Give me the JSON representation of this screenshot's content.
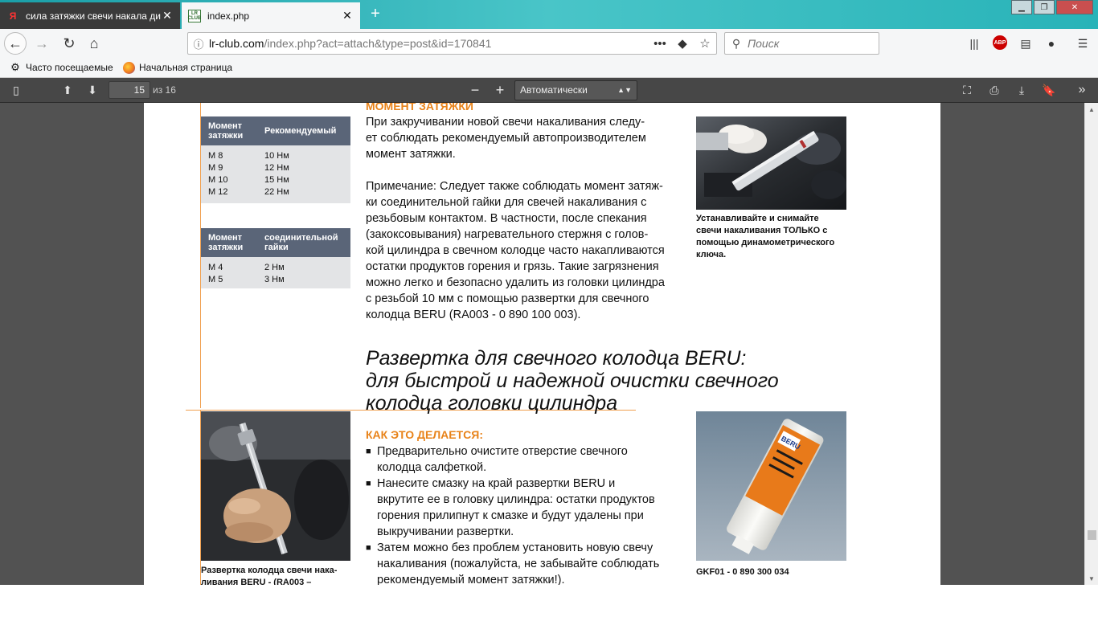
{
  "browser": {
    "tabs": [
      {
        "title": "сила затяжки свечи накала ди",
        "favicon": "Я",
        "active": false
      },
      {
        "title": "index.php",
        "favicon": "LR CLUB",
        "active": true
      }
    ],
    "url": {
      "domain": "lr-club.com",
      "path": "/index.php?act=attach&type=post&id=170841"
    },
    "search_placeholder": "Поиск",
    "bookmarks": [
      {
        "label": "Часто посещаемые",
        "icon": "gear-icon"
      },
      {
        "label": "Начальная страница",
        "icon": "firefox-icon"
      }
    ]
  },
  "pdf_toolbar": {
    "page_number": "15",
    "page_of": "из 16",
    "zoom": "Автоматически"
  },
  "document": {
    "torque_table1": {
      "col1": [
        "Момент",
        "затяжки"
      ],
      "col2": [
        "Рекомендуемый"
      ],
      "rows": [
        [
          "М 8",
          "10 Нм"
        ],
        [
          "М 9",
          "12 Нм"
        ],
        [
          "М 10",
          "15 Нм"
        ],
        [
          "М 12",
          "22 Нм"
        ]
      ]
    },
    "torque_table2": {
      "col1": [
        "Момент",
        "затяжки"
      ],
      "col2": [
        "соединительной",
        "гайки"
      ],
      "rows": [
        [
          "М 4",
          "2 Нм"
        ],
        [
          "М 5",
          "3 Нм"
        ]
      ]
    },
    "section_header": "МОМЕНТ ЗАТЯЖКИ",
    "intro_lines": [
      "При закручивании новой свечи накаливания следу-",
      "ет соблюдать рекомендуемый автопроизводителем",
      "момент затяжки."
    ],
    "note_lines": [
      "Примечание: Следует также соблюдать момент затяж-",
      "ки соединительной гайки для свечей накаливания с",
      "резьбовым контактом. В частности, после спекания",
      "(закоксовывания) нагревательного стержня с голов-",
      "кой цилиндра в свечном колодце часто накапливаются",
      "остатки продуктов горения и грязь. Такие загрязнения",
      "можно легко и безопасно удалить из головки цилиндра",
      "с резьбой 10 мм с помощью развертки для свечного",
      "колодца BERU (RA003 - 0 890 100 003)."
    ],
    "photo1_caption": [
      "Устанавливайте и снимайте",
      "свечи накаливания ТОЛЬКО с",
      "помощью динамометрического",
      "ключа."
    ],
    "big_title": [
      "Развертка для свечного колодца BERU:",
      "для быстрой и надежной очистки свечного",
      "колодца головки цилиндра"
    ],
    "how_header": "КАК ЭТО ДЕЛАЕТСЯ:",
    "bullets": [
      [
        "Предварительно очистите отверстие свечного",
        "колодца салфеткой."
      ],
      [
        "Нанесите смазку на край развертки BERU и",
        "вкрутите ее в головку цилиндра: остатки продуктов",
        "горения прилипнут к смазке и будут удалены при",
        "выкручивании развертки."
      ],
      [
        "Затем можно без проблем установить новую свечу",
        "накаливания (пожалуйста, не забывайте соблюдать",
        "рекомендуемый момент затяжки!)."
      ]
    ],
    "photo2_caption": [
      "Развертка колодца свечи нака-",
      "ливания BERU - (RA003 –"
    ],
    "photo3_caption": "GKF01 - 0 890 300 034",
    "tube_brand": "BERU"
  }
}
